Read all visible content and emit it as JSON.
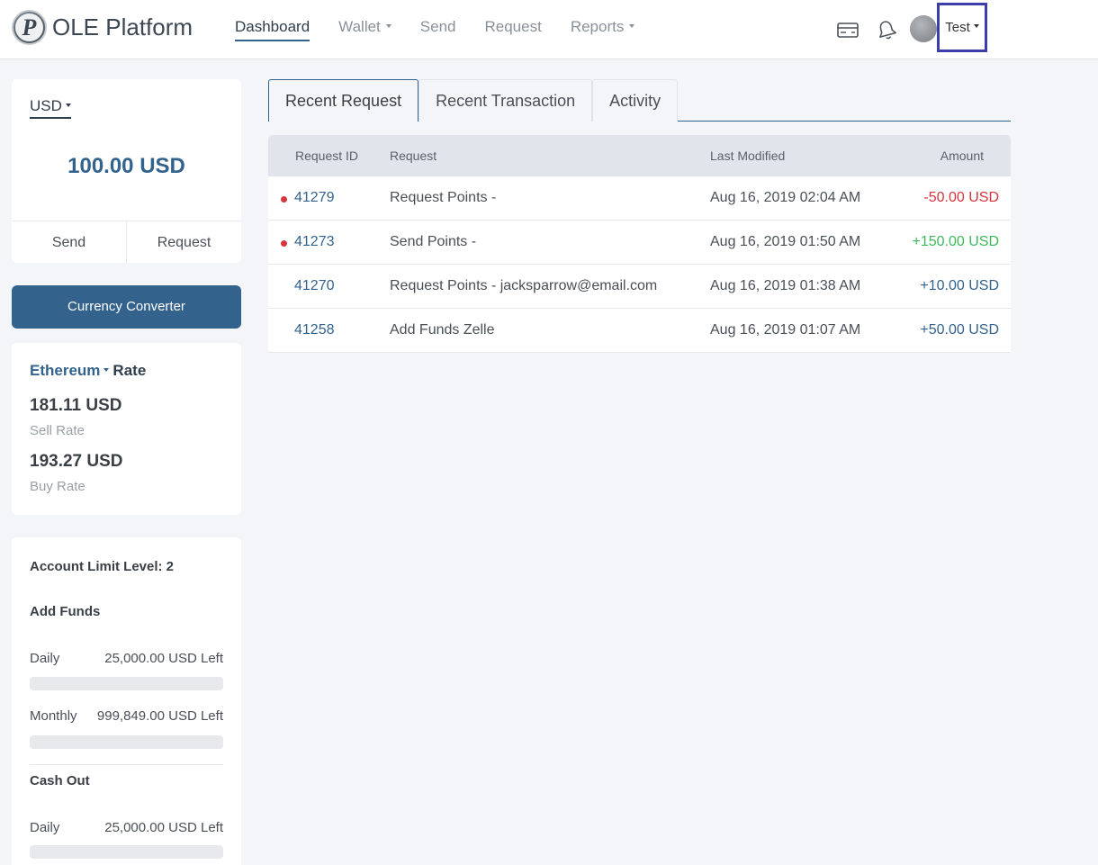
{
  "header": {
    "brand_letter": "P",
    "brand_name": "OLE Platform",
    "nav": [
      {
        "label": "Dashboard",
        "active": true,
        "has_caret": false
      },
      {
        "label": "Wallet",
        "active": false,
        "has_caret": true
      },
      {
        "label": "Send",
        "active": false,
        "has_caret": false
      },
      {
        "label": "Request",
        "active": false,
        "has_caret": false
      },
      {
        "label": "Reports",
        "active": false,
        "has_caret": true
      }
    ],
    "icons": [
      "credit-card-icon",
      "bell-icon"
    ],
    "user_name": "Test",
    "highlight_color": "#3d3eab"
  },
  "balance": {
    "currency": "USD",
    "amount": "100.00 USD",
    "send_label": "Send",
    "request_label": "Request"
  },
  "converter": {
    "label": "Currency Converter"
  },
  "rates": {
    "coin": "Ethereum",
    "title_suffix": "Rate",
    "sell_value": "181.11 USD",
    "sell_label": "Sell Rate",
    "buy_value": "193.27 USD",
    "buy_label": "Buy Rate"
  },
  "limits": {
    "title": "Account Limit Level: 2",
    "add_funds_title": "Add Funds",
    "add_daily_label": "Daily",
    "add_daily_value": "25,000.00 USD Left",
    "add_monthly_label": "Monthly",
    "add_monthly_value": "999,849.00 USD Left",
    "cash_out_title": "Cash Out",
    "cash_daily_label": "Daily",
    "cash_daily_value": "25,000.00 USD Left"
  },
  "tabs": [
    {
      "label": "Recent Request",
      "active": true
    },
    {
      "label": "Recent Transaction",
      "active": false
    },
    {
      "label": "Activity",
      "active": false
    }
  ],
  "table": {
    "columns": [
      "Request ID",
      "Request",
      "Last Modified",
      "Amount"
    ],
    "rows": [
      {
        "unread": true,
        "id": "41279",
        "request": "Request Points -",
        "modified": "Aug 16, 2019 02:04 AM",
        "amount": "-50.00 USD",
        "tone": "neg"
      },
      {
        "unread": true,
        "id": "41273",
        "request": "Send Points -",
        "modified": "Aug 16, 2019 01:50 AM",
        "amount": "+150.00 USD",
        "tone": "pos"
      },
      {
        "unread": false,
        "id": "41270",
        "request": "Request Points - jacksparrow@email.com",
        "modified": "Aug 16, 2019 01:38 AM",
        "amount": "+10.00 USD",
        "tone": "neutral"
      },
      {
        "unread": false,
        "id": "41258",
        "request": "Add Funds Zelle",
        "modified": "Aug 16, 2019 01:07 AM",
        "amount": "+50.00 USD",
        "tone": "neutral"
      }
    ]
  },
  "colors": {
    "primary": "#33628d",
    "negative": "#d6353d",
    "positive": "#3cb95a"
  }
}
